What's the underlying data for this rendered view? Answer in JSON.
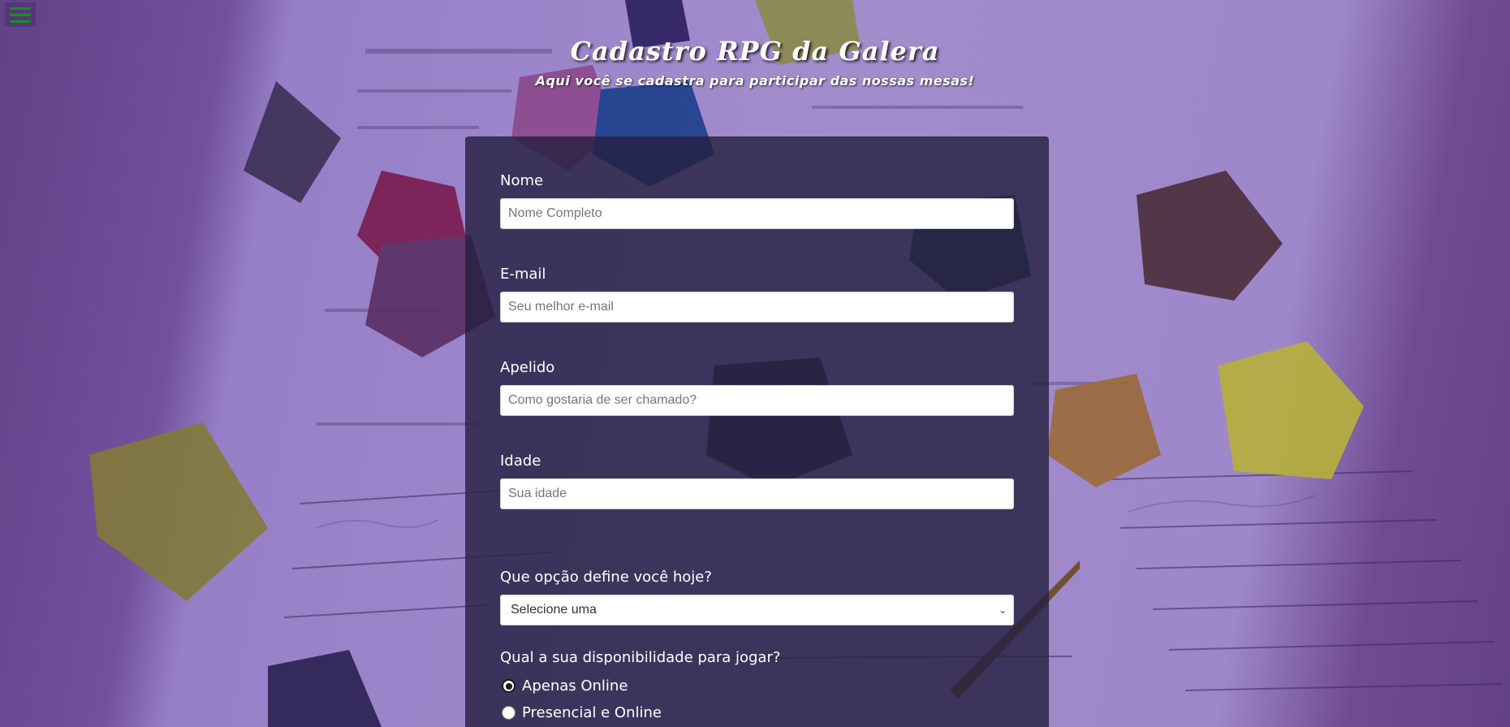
{
  "menu": {
    "icon": "hamburger-menu-icon",
    "color": "#1c8f1c"
  },
  "header": {
    "title": "Cadastro RPG da Galera",
    "subtitle": "Aqui você se cadastra para participar das nossas mesas!"
  },
  "form": {
    "nome": {
      "label": "Nome",
      "placeholder": "Nome Completo"
    },
    "email": {
      "label": "E-mail",
      "placeholder": "Seu melhor e-mail"
    },
    "apelido": {
      "label": "Apelido",
      "placeholder": "Como gostaria de ser chamado?"
    },
    "idade": {
      "label": "Idade",
      "placeholder": "Sua idade"
    },
    "opcao": {
      "label": "Que opção define você hoje?",
      "selected": "Selecione uma"
    },
    "disponibilidade": {
      "label": "Qual a sua disponibilidade para jogar?",
      "options": [
        {
          "label": "Apenas Online",
          "checked": true
        },
        {
          "label": "Presencial e Online",
          "checked": false
        }
      ]
    }
  },
  "colors": {
    "panel": "#262142",
    "overlay": "#7654ba",
    "menu_accent": "#1c8f1c"
  }
}
